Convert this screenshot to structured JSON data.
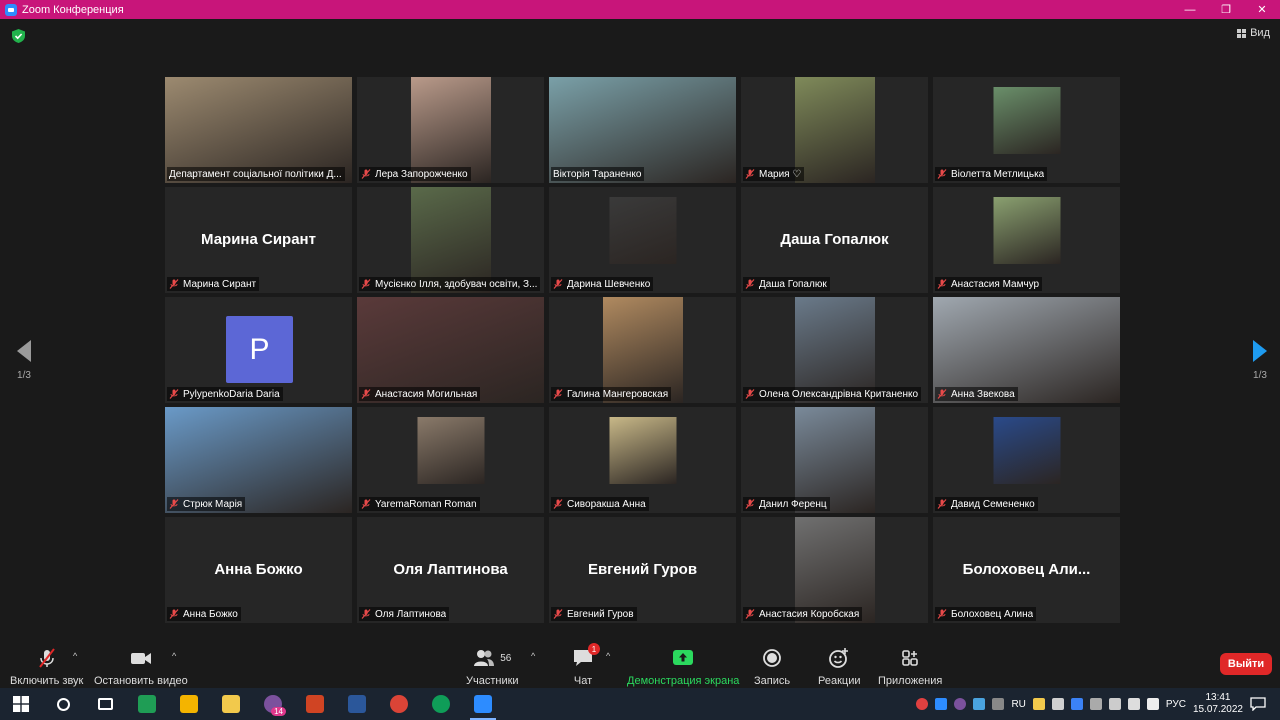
{
  "window": {
    "title": "Zoom Конференция",
    "controls": [
      "—",
      "❐",
      "✕"
    ]
  },
  "view_button": {
    "label": "Вид"
  },
  "participants": [
    {
      "label": "Департамент соціальної політики Д...",
      "video": true,
      "muted": false
    },
    {
      "label": "Лера Запорожченко",
      "video": true,
      "muted": true
    },
    {
      "label": "Вікторія Тараненко",
      "video": true,
      "muted": false,
      "active": true
    },
    {
      "label": "Мария ♡",
      "video": true,
      "muted": true
    },
    {
      "label": "Віолетта Метлицька",
      "video": true,
      "muted": true
    },
    {
      "label": "Марина Сирант",
      "big_name": "Марина Сирант",
      "video": false,
      "muted": true
    },
    {
      "label": "Мусієнко Ілля, здобувач освіти, З...",
      "video": true,
      "muted": true
    },
    {
      "label": "Дарина Шевченко",
      "video": true,
      "muted": true
    },
    {
      "label": "Даша Гопалюк",
      "big_name": "Даша Гопалюк",
      "video": false,
      "muted": true
    },
    {
      "label": "Анастасия Мамчур",
      "video": true,
      "muted": true
    },
    {
      "label": "PylypenkoDaria Daria",
      "avatar_letter": "P",
      "video": false,
      "muted": true
    },
    {
      "label": "Анастасия Могильная",
      "video": true,
      "muted": true
    },
    {
      "label": "Галина Мангеровская",
      "video": true,
      "muted": true
    },
    {
      "label": "Олена Олександрівна Кританенко",
      "video": true,
      "muted": true
    },
    {
      "label": "Анна Звекова",
      "video": true,
      "muted": true
    },
    {
      "label": "Стрюк Марія",
      "video": true,
      "muted": true
    },
    {
      "label": "YaremaRoman Roman",
      "video": true,
      "muted": true
    },
    {
      "label": "Сиворакша Анна",
      "video": true,
      "muted": true
    },
    {
      "label": "Данил Ференц",
      "video": true,
      "muted": true
    },
    {
      "label": "Давид Семененко",
      "video": true,
      "muted": true
    },
    {
      "label": "Анна Божко",
      "big_name": "Анна Божко",
      "video": false,
      "muted": true
    },
    {
      "label": "Оля Лаптинова",
      "big_name": "Оля Лаптинова",
      "video": false,
      "muted": true
    },
    {
      "label": "Евгений Гуров",
      "big_name": "Евгений Гуров",
      "video": false,
      "muted": true
    },
    {
      "label": "Анастасия Коробская",
      "video": true,
      "muted": true
    },
    {
      "label": "Болоховец Алина",
      "big_name": "Болоховец  Али...",
      "video": false,
      "muted": true
    }
  ],
  "pager": {
    "left": "1/3",
    "right": "1/3"
  },
  "toolbar": {
    "unmute": "Включить звук",
    "start_video": "Остановить видео",
    "participants_label": "Участники",
    "participants_count": "56",
    "chat": "Чат",
    "chat_badge": "1",
    "share": "Демонстрация экрана",
    "record": "Запись",
    "reactions": "Реакции",
    "apps": "Приложения",
    "end": "Выйти"
  },
  "taskbar": {
    "apps": [
      {
        "icon": "search-icon",
        "color": "#ffffff"
      },
      {
        "icon": "task-view-icon",
        "color": "#ffffff"
      },
      {
        "icon": "excel-icon",
        "color": "#1f9d55"
      },
      {
        "icon": "drive-icon",
        "color": "#f4b400"
      },
      {
        "icon": "explorer-icon",
        "color": "#f2c94c"
      },
      {
        "icon": "viber-icon",
        "color": "#7b519d",
        "badge": "14"
      },
      {
        "icon": "powerpoint-icon",
        "color": "#d04423"
      },
      {
        "icon": "word-icon",
        "color": "#2b579a"
      },
      {
        "icon": "chrome-icon",
        "color": "#db4437"
      },
      {
        "icon": "chrome-icon-2",
        "color": "#0f9d58"
      },
      {
        "icon": "zoom-icon",
        "color": "#2d8cff",
        "active": true
      }
    ],
    "lang_short": "RU",
    "lang": "РУС",
    "time": "13:41",
    "date": "15.07.2022"
  }
}
